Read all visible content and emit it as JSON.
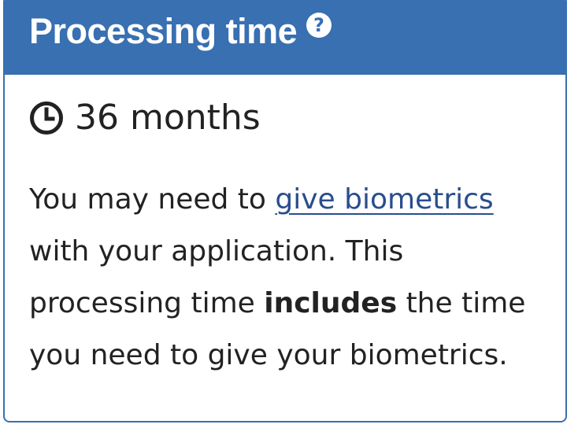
{
  "panel": {
    "title": "Processing time",
    "help_icon": "question-circle-icon",
    "help_glyph": "?",
    "clock_icon": "clock-icon",
    "duration": "36 months",
    "text_before_link": "You may need to ",
    "link_text": "give biometrics",
    "text_after_link": " with your application. This processing time ",
    "emphasis": "includes",
    "text_end": " the time you need to give your biometrics."
  },
  "colors": {
    "header_bg": "#3870b1",
    "border": "#3870b1",
    "link": "#284e8c",
    "text": "#222222"
  }
}
